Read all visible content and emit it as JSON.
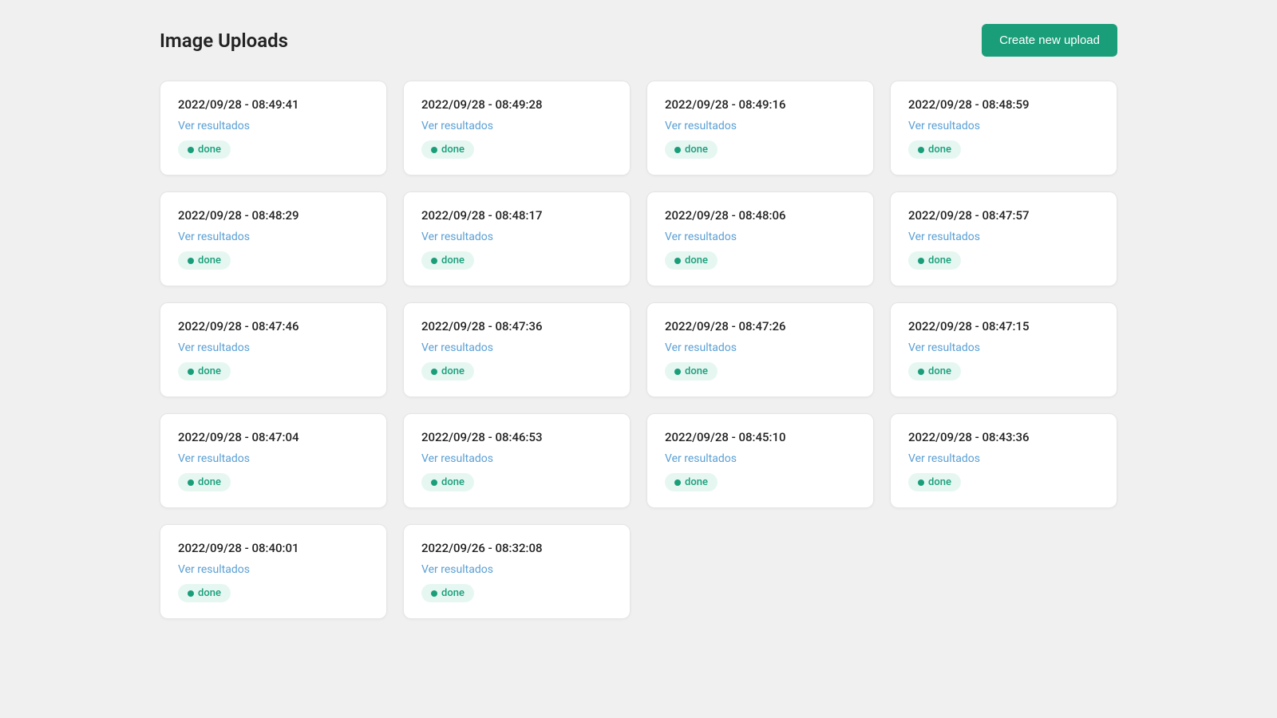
{
  "header": {
    "title": "Image Uploads",
    "create_button_label": "Create new upload"
  },
  "cards": [
    {
      "timestamp": "2022/09/28 - 08:49:41",
      "link_label": "Ver resultados",
      "status": "done"
    },
    {
      "timestamp": "2022/09/28 - 08:49:28",
      "link_label": "Ver resultados",
      "status": "done"
    },
    {
      "timestamp": "2022/09/28 - 08:49:16",
      "link_label": "Ver resultados",
      "status": "done"
    },
    {
      "timestamp": "2022/09/28 - 08:48:59",
      "link_label": "Ver resultados",
      "status": "done"
    },
    {
      "timestamp": "2022/09/28 - 08:48:29",
      "link_label": "Ver resultados",
      "status": "done"
    },
    {
      "timestamp": "2022/09/28 - 08:48:17",
      "link_label": "Ver resultados",
      "status": "done"
    },
    {
      "timestamp": "2022/09/28 - 08:48:06",
      "link_label": "Ver resultados",
      "status": "done"
    },
    {
      "timestamp": "2022/09/28 - 08:47:57",
      "link_label": "Ver resultados",
      "status": "done"
    },
    {
      "timestamp": "2022/09/28 - 08:47:46",
      "link_label": "Ver resultados",
      "status": "done"
    },
    {
      "timestamp": "2022/09/28 - 08:47:36",
      "link_label": "Ver resultados",
      "status": "done"
    },
    {
      "timestamp": "2022/09/28 - 08:47:26",
      "link_label": "Ver resultados",
      "status": "done"
    },
    {
      "timestamp": "2022/09/28 - 08:47:15",
      "link_label": "Ver resultados",
      "status": "done"
    },
    {
      "timestamp": "2022/09/28 - 08:47:04",
      "link_label": "Ver resultados",
      "status": "done"
    },
    {
      "timestamp": "2022/09/28 - 08:46:53",
      "link_label": "Ver resultados",
      "status": "done"
    },
    {
      "timestamp": "2022/09/28 - 08:45:10",
      "link_label": "Ver resultados",
      "status": "done"
    },
    {
      "timestamp": "2022/09/28 - 08:43:36",
      "link_label": "Ver resultados",
      "status": "done"
    },
    {
      "timestamp": "2022/09/28 - 08:40:01",
      "link_label": "Ver resultados",
      "status": "done"
    },
    {
      "timestamp": "2022/09/26 - 08:32:08",
      "link_label": "Ver resultados",
      "status": "done"
    }
  ]
}
